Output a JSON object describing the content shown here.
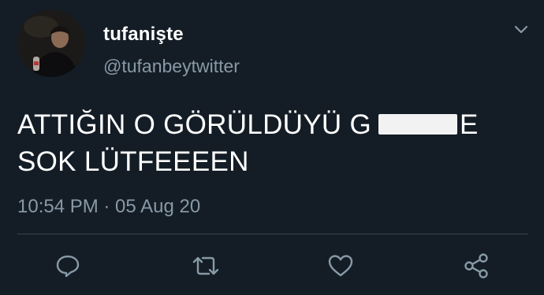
{
  "tweet": {
    "display_name": "tufanişte",
    "handle": "@tufanbeytwitter",
    "text_line1": "ATTIĞIN O GÖRÜLDÜYÜ G",
    "text_line1_end": "E",
    "text_line2": "SOK LÜTFEEEEN",
    "timestamp": "10:54 PM · 05 Aug 20"
  },
  "icons": {
    "menu": "chevron-down-icon",
    "reply": "reply-icon",
    "retweet": "retweet-icon",
    "like": "heart-icon",
    "share": "share-icon"
  },
  "colors": {
    "background": "#141d26",
    "secondary_text": "#8899a6",
    "divider": "#38444d"
  }
}
